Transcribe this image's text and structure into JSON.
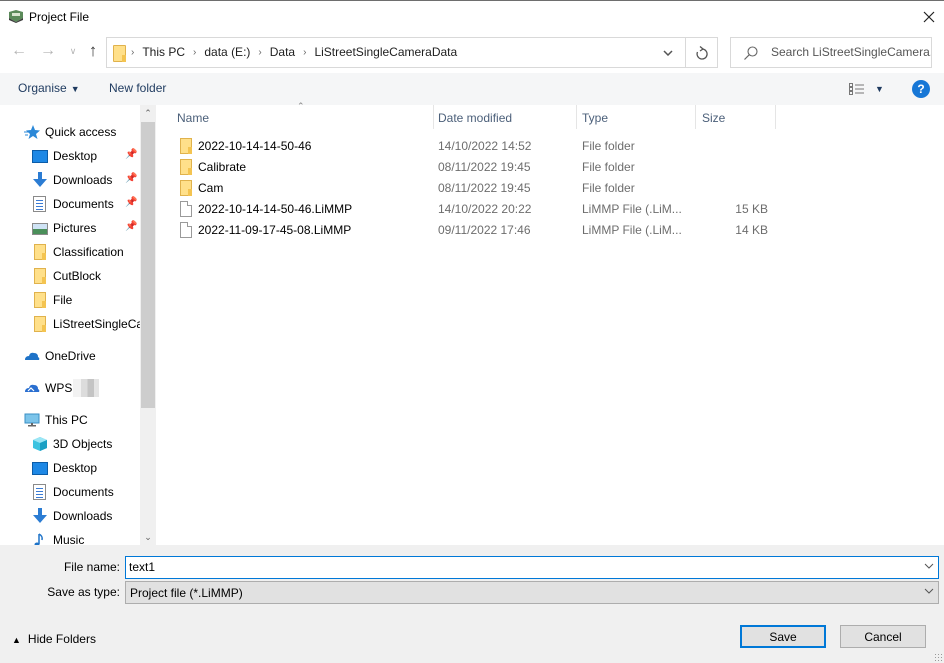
{
  "window": {
    "title": "Project File",
    "app_icon": "app-logo-icon",
    "close_icon": "close-icon"
  },
  "nav": {
    "back_icon": "arrow-left-icon",
    "forward_icon": "arrow-right-icon",
    "recent_icon": "chevron-down-icon",
    "up_icon": "arrow-up-icon",
    "breadcrumbs": [
      "This PC",
      "data (E:)",
      "Data",
      "LiStreetSingleCameraData"
    ],
    "refresh_icon": "refresh-icon",
    "search_placeholder": "Search LiStreetSingleCamera..."
  },
  "toolbar": {
    "organise_label": "Organise",
    "new_folder_label": "New folder",
    "view_icon": "details-view-icon",
    "help_label": "?"
  },
  "sidebar": {
    "items": [
      {
        "label": "Quick access",
        "icon": "star-icon",
        "pinned": false
      },
      {
        "label": "Desktop",
        "icon": "desktop-icon",
        "pinned": true
      },
      {
        "label": "Downloads",
        "icon": "download-arrow-icon",
        "pinned": true
      },
      {
        "label": "Documents",
        "icon": "documents-icon",
        "pinned": true
      },
      {
        "label": "Pictures",
        "icon": "pictures-icon",
        "pinned": true
      },
      {
        "label": "Classification",
        "icon": "folder-icon",
        "pinned": false
      },
      {
        "label": "CutBlock",
        "icon": "folder-icon",
        "pinned": false
      },
      {
        "label": "File",
        "icon": "folder-icon",
        "pinned": false
      },
      {
        "label": "LiStreetSingleCa",
        "icon": "folder-icon",
        "pinned": false
      },
      {
        "label": "OneDrive",
        "icon": "cloud-icon",
        "pinned": false
      },
      {
        "label": "WPS",
        "icon": "wps-cloud-icon",
        "pinned": false
      },
      {
        "label": "This PC",
        "icon": "computer-icon",
        "pinned": false
      },
      {
        "label": "3D Objects",
        "icon": "cube-icon",
        "pinned": false
      },
      {
        "label": "Desktop",
        "icon": "desktop-icon",
        "pinned": false
      },
      {
        "label": "Documents",
        "icon": "documents-icon",
        "pinned": false
      },
      {
        "label": "Downloads",
        "icon": "download-arrow-icon",
        "pinned": false
      },
      {
        "label": "Music",
        "icon": "music-note-icon",
        "pinned": false
      }
    ]
  },
  "filelist": {
    "columns": [
      "Name",
      "Date modified",
      "Type",
      "Size"
    ],
    "sorted_by": "Name",
    "rows": [
      {
        "name": "2022-10-14-14-50-46",
        "date": "14/10/2022 14:52",
        "type": "File folder",
        "size": "",
        "kind": "folder"
      },
      {
        "name": "Calibrate",
        "date": "08/11/2022 19:45",
        "type": "File folder",
        "size": "",
        "kind": "folder"
      },
      {
        "name": "Cam",
        "date": "08/11/2022 19:45",
        "type": "File folder",
        "size": "",
        "kind": "folder"
      },
      {
        "name": "2022-10-14-14-50-46.LiMMP",
        "date": "14/10/2022 20:22",
        "type": "LiMMP File (.LiM...",
        "size": "15 KB",
        "kind": "file"
      },
      {
        "name": "2022-11-09-17-45-08.LiMMP",
        "date": "09/11/2022 17:46",
        "type": "LiMMP File (.LiM...",
        "size": "14 KB",
        "kind": "file"
      }
    ]
  },
  "footer": {
    "file_name_label": "File name:",
    "file_name_value": "text1",
    "save_as_type_label": "Save as type:",
    "save_as_type_value": "Project file (*.LiMMP)",
    "hide_folders_label": "Hide Folders",
    "save_label": "Save",
    "cancel_label": "Cancel"
  },
  "colors": {
    "accent": "#0078d7",
    "help": "#1777d6",
    "folder": "#ffe08a",
    "toolbar_bg": "#f5f6f7",
    "footer_bg": "#f0f0f0"
  }
}
